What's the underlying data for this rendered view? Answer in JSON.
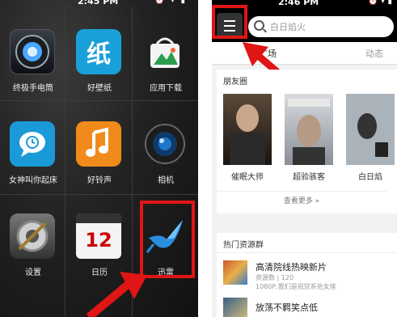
{
  "left": {
    "status_time": "2:45 PM",
    "apps": [
      {
        "label": "终极手电筒",
        "icon": "flashlight-icon"
      },
      {
        "label": "好壁纸",
        "icon": "wallpaper-icon"
      },
      {
        "label": "应用下载",
        "icon": "app-store-icon"
      },
      {
        "label": "女神叫你起床",
        "icon": "alarm-chat-icon"
      },
      {
        "label": "好铃声",
        "icon": "music-note-icon"
      },
      {
        "label": "相机",
        "icon": "camera-icon"
      },
      {
        "label": "设置",
        "icon": "settings-icon"
      },
      {
        "label": "日历",
        "icon": "calendar-icon"
      },
      {
        "label": "迅雷",
        "icon": "xunlei-bird-icon"
      }
    ],
    "calendar_day": "12",
    "wallpaper_glyph": "纸"
  },
  "right": {
    "status_time": "2:46 PM",
    "search_placeholder": "白日焰火",
    "tabs": [
      "广场",
      "动态"
    ],
    "friends_section": {
      "title": "朋友圈",
      "posters": [
        "催眠大师",
        "超验骇客",
        "白日焰"
      ],
      "more": "查看更多 »"
    },
    "hot_section": {
      "title": "热门资源群",
      "items": [
        {
          "title": "高清院线热映新片",
          "meta": "资源数 | 120",
          "desc": "1080P,我们是视觉系处女座"
        },
        {
          "title": "放荡不羁笑点低",
          "meta": "",
          "desc": ""
        }
      ]
    }
  },
  "colors": {
    "highlight_red": "#e01515",
    "arrow_red": "#e01515"
  }
}
